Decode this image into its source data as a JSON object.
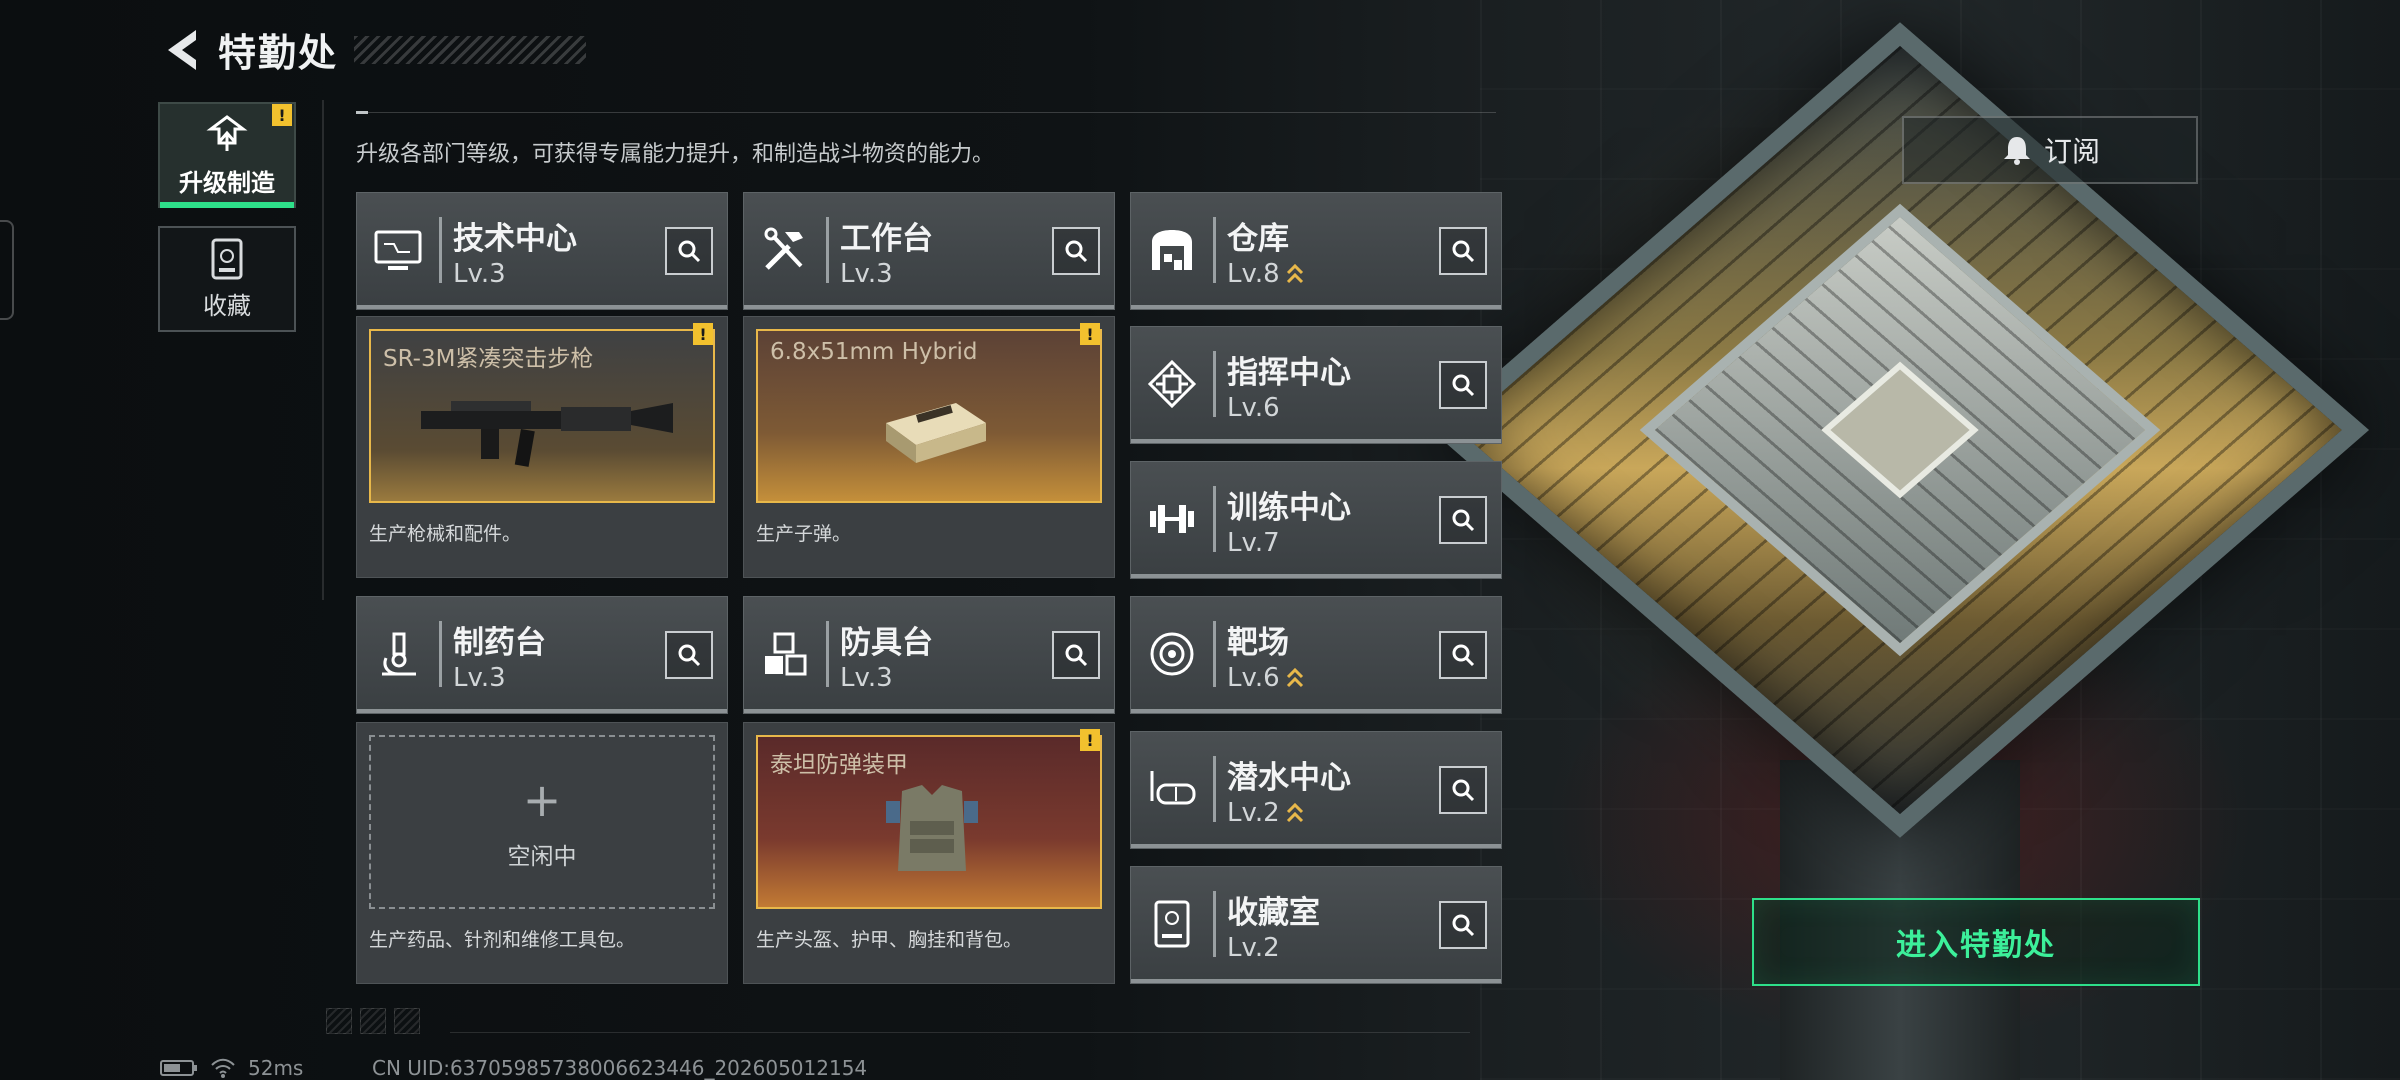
{
  "header": {
    "title": "特勤处"
  },
  "tabs": [
    {
      "label": "升级制造",
      "active": true,
      "alert": "!"
    },
    {
      "label": "收藏",
      "active": false
    }
  ],
  "description": "升级各部门等级，可获得专属能力提升，和制造战斗物资的能力。",
  "subscribe": {
    "label": "订阅",
    "icon": "bell-icon"
  },
  "departments": [
    {
      "name": "技术中心",
      "level": "Lv.3",
      "icon": "monitor-icon"
    },
    {
      "name": "工作台",
      "level": "Lv.3",
      "icon": "tools-icon"
    },
    {
      "name": "仓库",
      "level": "Lv.8",
      "icon": "warehouse-icon",
      "upgradable": true
    },
    {
      "name": "指挥中心",
      "level": "Lv.6",
      "icon": "chip-icon"
    },
    {
      "name": "训练中心",
      "level": "Lv.7",
      "icon": "dumbbell-icon"
    },
    {
      "name": "制药台",
      "level": "Lv.3",
      "icon": "microscope-icon"
    },
    {
      "name": "防具台",
      "level": "Lv.3",
      "icon": "blocks-icon"
    },
    {
      "name": "靶场",
      "level": "Lv.6",
      "icon": "target-icon",
      "upgradable": true
    },
    {
      "name": "潜水中心",
      "level": "Lv.2",
      "icon": "diving-mask-icon",
      "upgradable": true
    },
    {
      "name": "收藏室",
      "level": "Lv.2",
      "icon": "showcase-icon"
    }
  ],
  "production": [
    {
      "item": "SR-3M紧凑突击步枪",
      "desc": "生产枪械和配件。",
      "alert": "!"
    },
    {
      "item": "6.8x51mm Hybrid",
      "desc": "生产子弹。",
      "alert": "!"
    },
    {
      "item": "",
      "idle_label": "空闲中",
      "plus": "+",
      "desc": "生产药品、针剂和维修工具包。"
    },
    {
      "item": "泰坦防弹装甲",
      "desc": "生产头盔、护甲、胸挂和背包。",
      "alert": "!"
    }
  ],
  "enter_button": {
    "label": "进入特勤处"
  },
  "status": {
    "ping": "52ms",
    "uid": "CN UID:6370598573800662​3446_202605012154"
  },
  "colors": {
    "accent": "#2ee08a",
    "alert": "#f2c12e",
    "slot_border": "#e8b84a",
    "upgrade_arrow": "#e8b84a"
  }
}
